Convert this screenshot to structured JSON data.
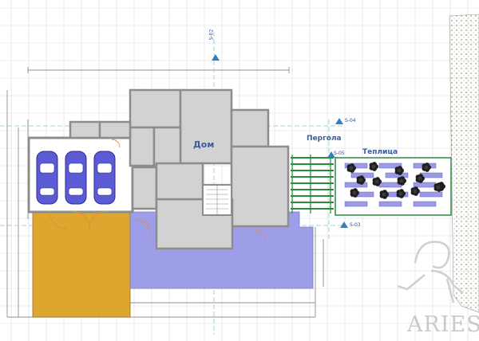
{
  "labels": {
    "house": "Дом",
    "pergola": "Пергола",
    "greenhouse": "Теплица"
  },
  "section_marks": [
    {
      "id": "s02",
      "text": "S-02"
    },
    {
      "id": "s03",
      "text": "S-03"
    },
    {
      "id": "s04",
      "text": "S-04"
    },
    {
      "id": "s05",
      "text": "S-05"
    }
  ],
  "logo": {
    "text": "ARIES"
  },
  "colors": {
    "background": "#ffffff",
    "grid": "#dcdcdc",
    "room_fill": "#d2d2d2",
    "wall": "#8d8d8d",
    "terrace": "#9e9ee8",
    "parking_pad": "#dea52f",
    "car_body": "#5b5bd6",
    "pergola": "#2a8a3c",
    "greenhouse_bed": "#9a9ae6",
    "accent_text": "#3a5ba0",
    "door": "#e09030"
  },
  "drawing": {
    "car_count": 3,
    "shrub_count": 14
  }
}
